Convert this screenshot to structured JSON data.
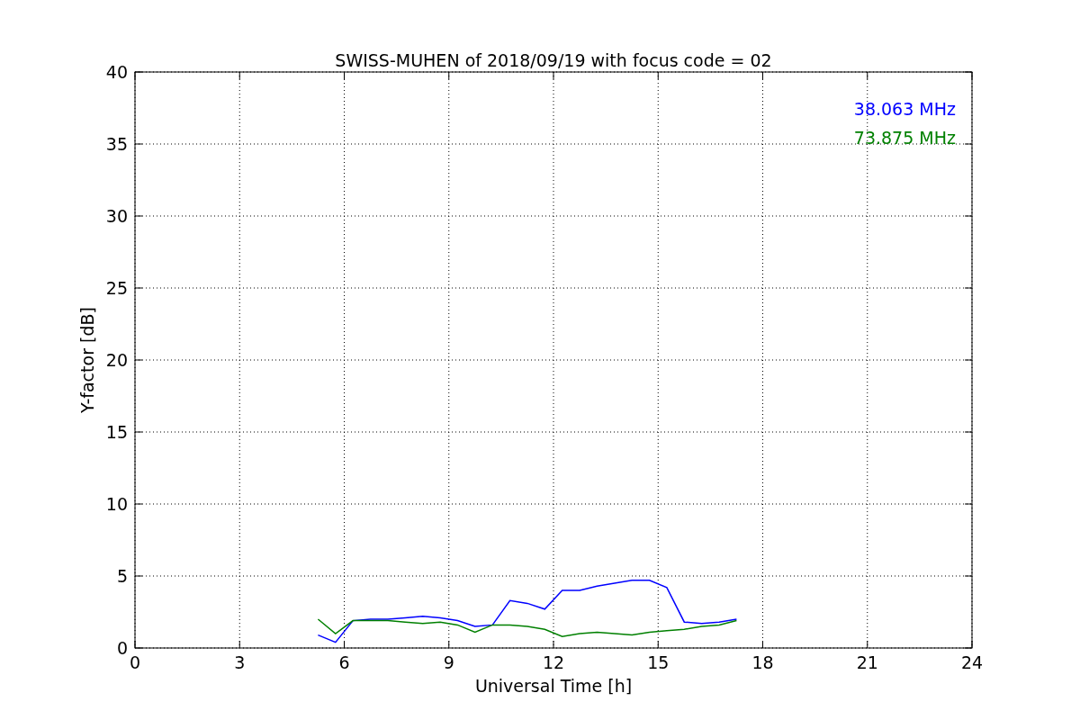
{
  "chart_data": {
    "type": "line",
    "title": "SWISS-MUHEN of 2018/09/19 with focus code = 02",
    "xlabel": "Universal Time [h]",
    "ylabel": "Y-factor [dB]",
    "grid": true,
    "xlim": [
      0,
      24
    ],
    "ylim": [
      0,
      40
    ],
    "xticks": [
      0,
      3,
      6,
      9,
      12,
      15,
      18,
      21,
      24
    ],
    "yticks": [
      0,
      5,
      10,
      15,
      20,
      25,
      30,
      35,
      40
    ],
    "x": [
      5.25,
      5.75,
      6.25,
      6.75,
      7.25,
      7.75,
      8.25,
      8.75,
      9.25,
      9.75,
      10.25,
      10.75,
      11.25,
      11.75,
      12.25,
      12.75,
      13.25,
      13.75,
      14.25,
      14.75,
      15.25,
      15.75,
      16.25,
      16.75,
      17.25
    ],
    "series": [
      {
        "name": "38.063 MHz",
        "color": "#0000ff",
        "values": [
          0.9,
          0.4,
          1.9,
          2.0,
          2.0,
          2.1,
          2.2,
          2.1,
          1.9,
          1.5,
          1.6,
          3.3,
          3.1,
          2.7,
          4.0,
          4.0,
          4.3,
          4.5,
          4.7,
          4.7,
          4.2,
          1.8,
          1.7,
          1.8,
          2.0
        ]
      },
      {
        "name": "73.875 MHz",
        "color": "#008000",
        "values": [
          2.0,
          1.0,
          1.9,
          1.9,
          1.9,
          1.8,
          1.7,
          1.8,
          1.6,
          1.1,
          1.6,
          1.6,
          1.5,
          1.3,
          0.8,
          1.0,
          1.1,
          1.0,
          0.9,
          1.1,
          1.2,
          1.3,
          1.5,
          1.6,
          1.9
        ]
      }
    ]
  }
}
